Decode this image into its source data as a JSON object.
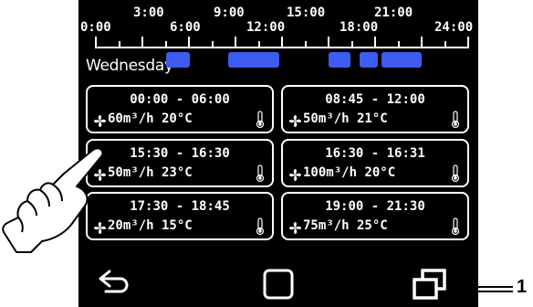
{
  "timeline": {
    "labels": [
      "0:00",
      "3:00",
      "6:00",
      "9:00",
      "12:00",
      "15:00",
      "18:00",
      "21:00",
      "24:00"
    ],
    "day": "Wednesday",
    "bar_color": "#3d5cf0"
  },
  "schedules": [
    {
      "time": "00:00 - 06:00",
      "flow": "60m³/h 20°C"
    },
    {
      "time": "08:45 - 12:00",
      "flow": "50m³/h 21°C"
    },
    {
      "time": "15:30 - 16:30",
      "flow": "50m³/h 23°C"
    },
    {
      "time": "16:30 - 16:31",
      "flow": "100m³/h 20°C"
    },
    {
      "time": "17:30 - 18:45",
      "flow": "20m³/h 15°C"
    },
    {
      "time": "19:00 - 21:30",
      "flow": "75m³/h 25°C"
    }
  ],
  "nav": {
    "back_icon": "back-arrow-icon",
    "home_icon": "square-home-icon",
    "recent_icon": "overlapping-windows-icon"
  },
  "callout": {
    "number": "1"
  },
  "icons": {
    "fan": "fan-icon",
    "thermometer": "thermometer-icon",
    "hand": "pointing-hand-icon"
  }
}
